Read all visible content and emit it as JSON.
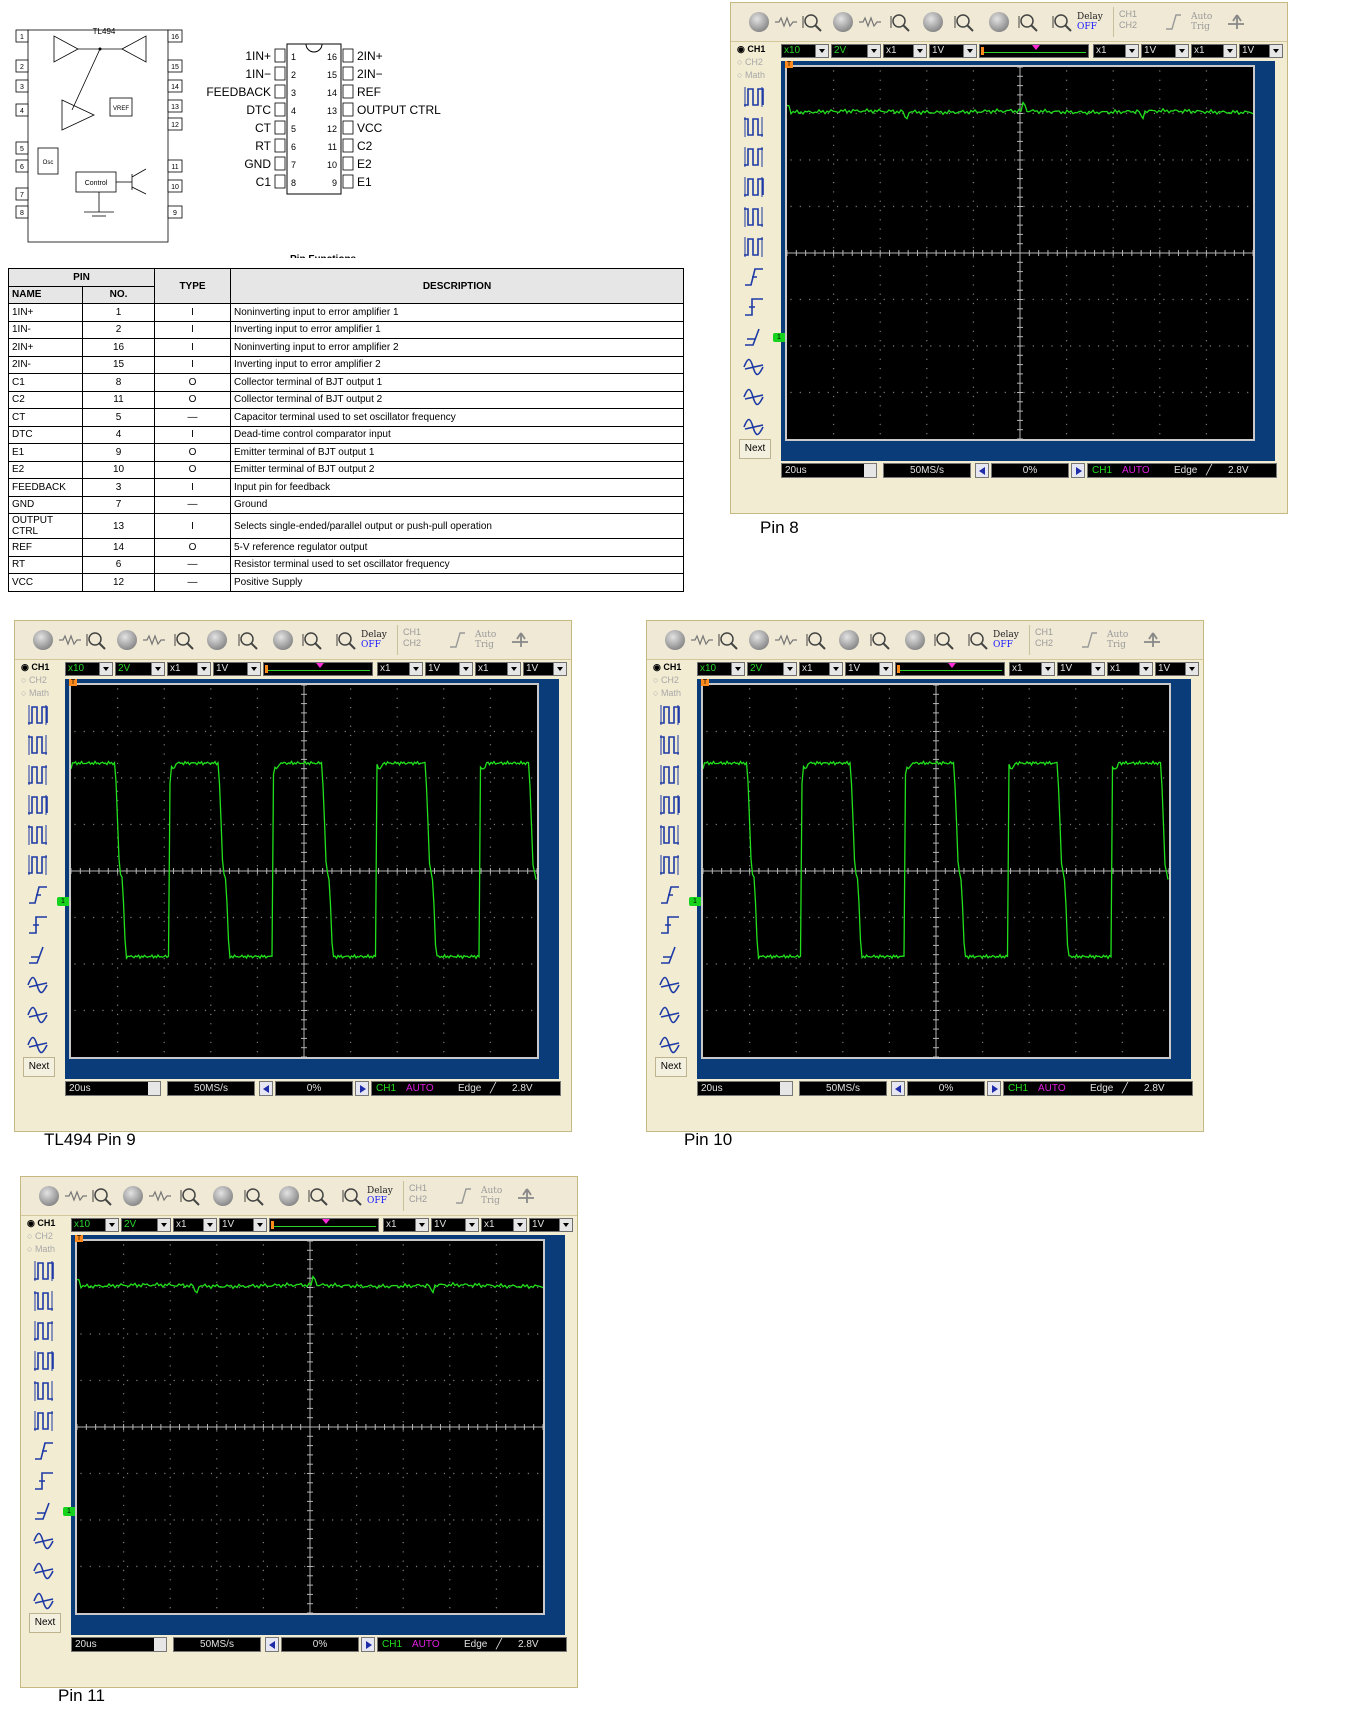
{
  "block_diagram": {
    "title": "TL494",
    "left_pins": [
      "1",
      "2",
      "3",
      "4",
      "5",
      "6",
      "7",
      "8"
    ],
    "right_pins": [
      "16",
      "15",
      "14",
      "13",
      "12",
      "11",
      "10",
      "9"
    ],
    "vref_label": "VREF",
    "osc_label": "Osc",
    "control_label": "Control"
  },
  "pinout": {
    "left": [
      {
        "name": "1IN+",
        "no": "1"
      },
      {
        "name": "1IN−",
        "no": "2"
      },
      {
        "name": "FEEDBACK",
        "no": "3"
      },
      {
        "name": "DTC",
        "no": "4"
      },
      {
        "name": "CT",
        "no": "5"
      },
      {
        "name": "RT",
        "no": "6"
      },
      {
        "name": "GND",
        "no": "7"
      },
      {
        "name": "C1",
        "no": "8"
      }
    ],
    "right": [
      {
        "name": "2IN+",
        "no": "16"
      },
      {
        "name": "2IN−",
        "no": "15"
      },
      {
        "name": "REF",
        "no": "14"
      },
      {
        "name": "OUTPUT CTRL",
        "no": "13"
      },
      {
        "name": "VCC",
        "no": "12"
      },
      {
        "name": "C2",
        "no": "11"
      },
      {
        "name": "E2",
        "no": "10"
      },
      {
        "name": "E1",
        "no": "9"
      }
    ]
  },
  "pin_functions": {
    "heading": "Pin Functions",
    "header": {
      "pin": "PIN",
      "name": "NAME",
      "no": "NO.",
      "type": "TYPE",
      "description": "DESCRIPTION"
    },
    "rows": [
      {
        "name": "1IN+",
        "no": "1",
        "type": "I",
        "description": "Noninverting input to error amplifier 1"
      },
      {
        "name": "1IN-",
        "no": "2",
        "type": "I",
        "description": "Inverting input to error amplifier 1"
      },
      {
        "name": "2IN+",
        "no": "16",
        "type": "I",
        "description": "Noninverting input to error amplifier 2"
      },
      {
        "name": "2IN-",
        "no": "15",
        "type": "I",
        "description": "Inverting input to error amplifier 2"
      },
      {
        "name": "C1",
        "no": "8",
        "type": "O",
        "description": "Collector terminal of BJT output 1"
      },
      {
        "name": "C2",
        "no": "11",
        "type": "O",
        "description": "Collector terminal of BJT output 2"
      },
      {
        "name": "CT",
        "no": "5",
        "type": "—",
        "description": "Capacitor terminal used to set oscillator frequency"
      },
      {
        "name": "DTC",
        "no": "4",
        "type": "I",
        "description": "Dead-time control comparator input"
      },
      {
        "name": "E1",
        "no": "9",
        "type": "O",
        "description": "Emitter terminal of BJT output 1"
      },
      {
        "name": "E2",
        "no": "10",
        "type": "O",
        "description": "Emitter terminal of BJT output 2"
      },
      {
        "name": "FEEDBACK",
        "no": "3",
        "type": "I",
        "description": "Input pin for feedback"
      },
      {
        "name": "GND",
        "no": "7",
        "type": "—",
        "description": "Ground"
      },
      {
        "name": "OUTPUT CTRL",
        "no": "13",
        "type": "I",
        "description": "Selects single-ended/parallel output or push-pull operation"
      },
      {
        "name": "REF",
        "no": "14",
        "type": "O",
        "description": "5-V reference regulator output"
      },
      {
        "name": "RT",
        "no": "6",
        "type": "—",
        "description": "Resistor terminal used to set oscillator frequency"
      },
      {
        "name": "VCC",
        "no": "12",
        "type": "—",
        "description": "Positive Supply"
      }
    ]
  },
  "scope_ui": {
    "channels": [
      "CH1",
      "CH2",
      "Math"
    ],
    "delay_label": "Delay",
    "delay_value": "OFF",
    "trig_channels": [
      "CH1",
      "CH2"
    ],
    "auto_trig_label": [
      "Auto",
      "Trig"
    ],
    "ch1_probe": "x10",
    "ch1_volts": "2V",
    "ch2_probe": "x1",
    "ch2_volts": "1V",
    "math_probe": "x1",
    "math_volts": "1V",
    "ref_probe": "x1",
    "ref_volts": "1V",
    "next_label": "Next",
    "timebase": "20us",
    "sample_rate": "50MS/s",
    "trigger_position": "0%",
    "trigger_source": "CH1",
    "trigger_mode": "AUTO",
    "trigger_type": "Edge",
    "trigger_level": "2.8V",
    "trigger_marker": "T",
    "ground_marker": "1",
    "colors": {
      "trace": "#22e01c",
      "panel": "#0b3c7a",
      "mode": "#e01ee0"
    }
  },
  "scopes": [
    {
      "id": "pin8",
      "caption": "Pin 8",
      "trace": "flat"
    },
    {
      "id": "pin9",
      "caption": "TL494 Pin 9",
      "trace": "square"
    },
    {
      "id": "pin10",
      "caption": "Pin 10",
      "trace": "square"
    },
    {
      "id": "pin11",
      "caption": "Pin 11",
      "trace": "flat"
    }
  ]
}
